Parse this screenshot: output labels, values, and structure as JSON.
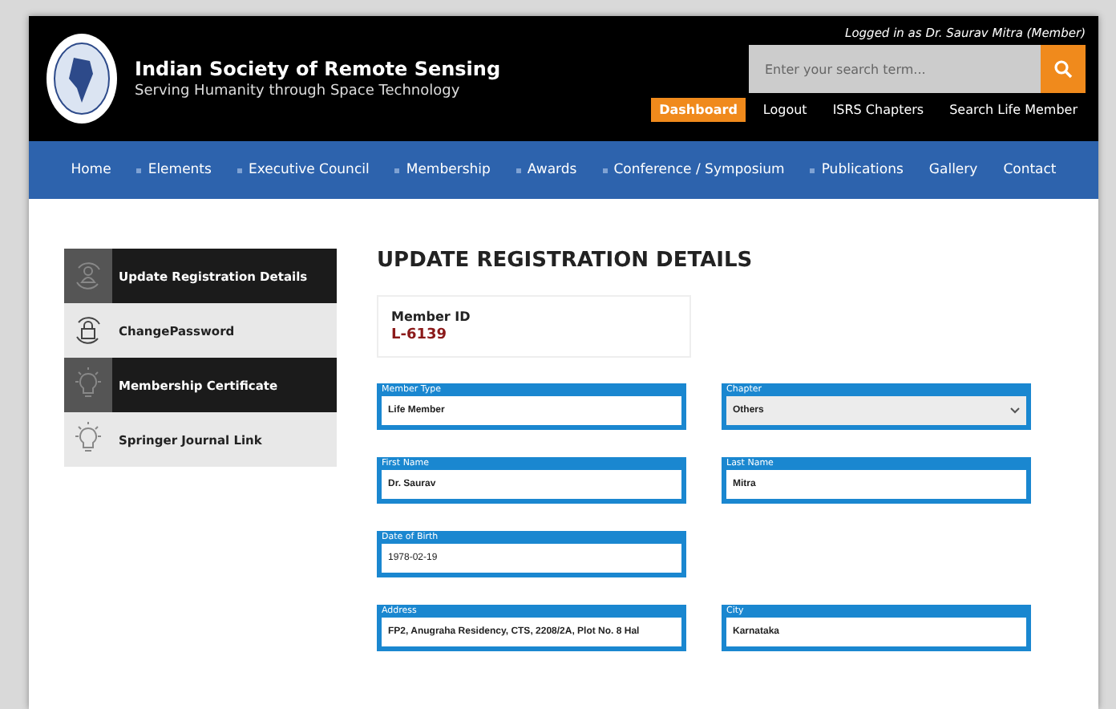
{
  "header": {
    "title": "Indian Society of Remote Sensing",
    "tagline": "Serving Humanity through Space Technology",
    "login_status": "Logged in as Dr. Saurav Mitra (Member)",
    "search": {
      "placeholder": "Enter your search term..."
    },
    "links": [
      {
        "label": "Dashboard",
        "selected": true
      },
      {
        "label": "Logout",
        "selected": false
      },
      {
        "label": "ISRS Chapters",
        "selected": false
      },
      {
        "label": "Search Life Member",
        "selected": false
      }
    ]
  },
  "nav": [
    {
      "label": "Home",
      "bullet": false
    },
    {
      "label": "Elements",
      "bullet": true
    },
    {
      "label": "Executive Council",
      "bullet": true
    },
    {
      "label": "Membership",
      "bullet": true
    },
    {
      "label": "Awards",
      "bullet": true
    },
    {
      "label": "Conference / Symposium",
      "bullet": true
    },
    {
      "label": "Publications",
      "bullet": true
    },
    {
      "label": "Gallery",
      "bullet": false
    },
    {
      "label": "Contact",
      "bullet": false
    }
  ],
  "sidebar": {
    "items": [
      {
        "label": "Update Registration Details",
        "kind": "person",
        "selected": true
      },
      {
        "label": "ChangePassword",
        "kind": "lock",
        "selected": false
      },
      {
        "label": "Membership Certificate",
        "kind": "bulb",
        "selected": true
      },
      {
        "label": "Springer Journal Link",
        "kind": "bulb",
        "selected": false
      }
    ]
  },
  "form": {
    "title": "UPDATE REGISTRATION DETAILS",
    "member_id_label": "Member ID",
    "member_id": "L-6139",
    "rows": [
      [
        {
          "label": "Member Type",
          "value": "Life Member",
          "kind": "text"
        },
        {
          "label": "Chapter",
          "value": "Others",
          "kind": "select"
        }
      ],
      [
        {
          "label": "First Name",
          "value": "Dr. Saurav",
          "kind": "text"
        },
        {
          "label": "Last Name",
          "value": "Mitra",
          "kind": "text"
        }
      ],
      [
        {
          "label": "Date of Birth",
          "value": "1978-02-19",
          "kind": "date"
        }
      ],
      [
        {
          "label": "Address",
          "value": "FP2, Anugraha Residency, CTS, 2208/2A, Plot No. 8 Hal",
          "kind": "text"
        },
        {
          "label": "City",
          "value": "Karnataka",
          "kind": "text"
        }
      ]
    ]
  }
}
